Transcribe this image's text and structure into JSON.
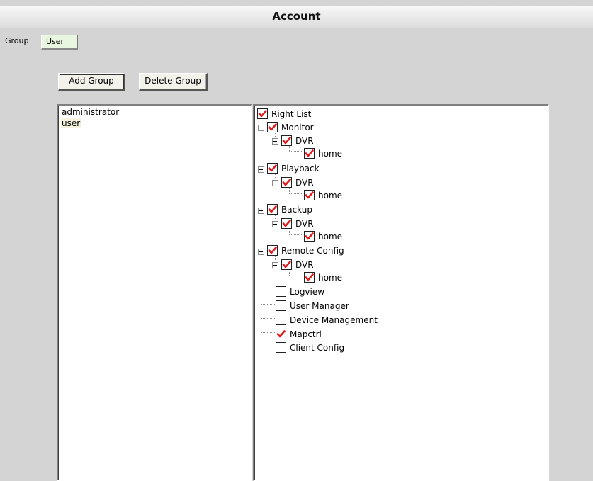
{
  "window": {
    "title": "Account"
  },
  "tabs": [
    {
      "label": "Group",
      "active": true
    },
    {
      "label": "User",
      "active": false
    }
  ],
  "toolbar": {
    "add_group_label": "Add Group",
    "delete_group_label": "Delete Group"
  },
  "groups": {
    "items": [
      {
        "label": "administrator",
        "selected": false
      },
      {
        "label": "user",
        "selected": true
      }
    ]
  },
  "rights_tree": {
    "root": {
      "label": "Right List",
      "checked": true
    },
    "nodes": [
      {
        "label": "Monitor",
        "checked": true
      },
      {
        "label": "DVR",
        "checked": true
      },
      {
        "label": "home",
        "checked": true
      },
      {
        "label": "Playback",
        "checked": true
      },
      {
        "label": "DVR",
        "checked": true
      },
      {
        "label": "home",
        "checked": true
      },
      {
        "label": "Backup",
        "checked": true
      },
      {
        "label": "DVR",
        "checked": true
      },
      {
        "label": "home",
        "checked": true
      },
      {
        "label": "Remote Config",
        "checked": true
      },
      {
        "label": "DVR",
        "checked": true
      },
      {
        "label": "home",
        "checked": true
      },
      {
        "label": "Logview",
        "checked": false
      },
      {
        "label": "User Manager",
        "checked": false
      },
      {
        "label": "Device Management",
        "checked": false
      },
      {
        "label": "Mapctrl",
        "checked": true
      },
      {
        "label": "Client Config",
        "checked": false
      }
    ]
  },
  "colors": {
    "check_mark": "#e21b1b",
    "background": "#d4d4d4",
    "user_tab": "#e9f7e1"
  }
}
